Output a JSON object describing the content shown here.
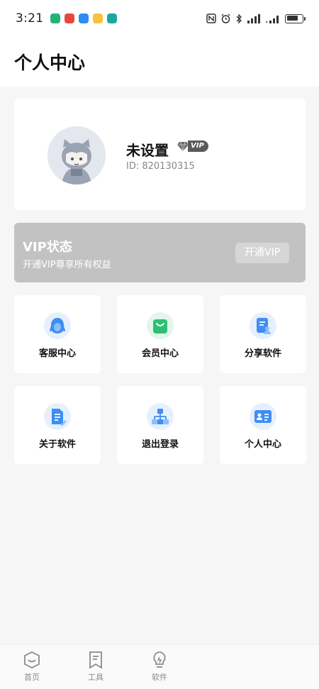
{
  "status_bar": {
    "time": "3:21",
    "notification_icons": [
      {
        "name": "app-green-icon",
        "color": "#21b573"
      },
      {
        "name": "app-red-icon",
        "color": "#e8473f"
      },
      {
        "name": "app-blue-cloud-icon",
        "color": "#2f8cf0"
      },
      {
        "name": "app-meituan-icon",
        "color": "#f7c23c"
      },
      {
        "name": "app-teal-icon",
        "color": "#1aa7a0"
      }
    ],
    "indicators": [
      "nfc-icon",
      "alarm-icon",
      "bluetooth-icon",
      "signal-icon",
      "wifi-signal-icon",
      "battery-icon"
    ]
  },
  "header": {
    "title": "个人中心"
  },
  "profile": {
    "name": "未设置",
    "vip_label": "VIP",
    "id_text": "ID: 820130315"
  },
  "vip_card": {
    "title": "VIP状态",
    "subtitle": "开通VIP尊享所有权益",
    "button_label": "开通VIP"
  },
  "menu_tiles": [
    {
      "label": "客服中心",
      "icon": "customer-service-icon",
      "color": "#3d8ef5"
    },
    {
      "label": "会员中心",
      "icon": "membership-bag-icon",
      "color": "#2fbf71"
    },
    {
      "label": "分享软件",
      "icon": "share-software-icon",
      "color": "#3d8ef5"
    },
    {
      "label": "关于软件",
      "icon": "about-document-icon",
      "color": "#3d8ef5"
    },
    {
      "label": "退出登录",
      "icon": "logout-sitemap-icon",
      "color": "#3d8ef5"
    },
    {
      "label": "个人中心",
      "icon": "personal-card-icon",
      "color": "#3d8ef5"
    }
  ],
  "bottom_nav": [
    {
      "label": "首页",
      "icon": "home-smile-icon"
    },
    {
      "label": "工具",
      "icon": "tools-bookmark-icon"
    },
    {
      "label": "软件",
      "icon": "software-lightbulb-icon"
    }
  ]
}
